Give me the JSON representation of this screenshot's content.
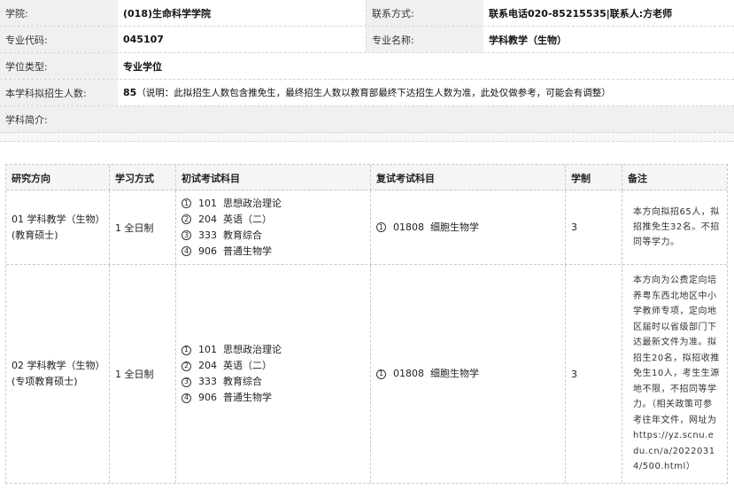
{
  "info": {
    "college_label": "学院:",
    "college_value": "(018)生命科学学院",
    "contact_label": "联系方式:",
    "contact_value": "联系电话020-85215535|联系人:方老师",
    "major_code_label": "专业代码:",
    "major_code_value": "045107",
    "major_name_label": "专业名称:",
    "major_name_value": "学科教学（生物）",
    "degree_type_label": "学位类型:",
    "degree_type_value": "专业学位",
    "enroll_label": "本学科拟招生人数:",
    "enroll_count": "85",
    "enroll_note": "（说明：此拟招生人数包含推免生，最终招生人数以教育部最终下达招生人数为准，此处仅做参考，可能会有调整）",
    "intro_label": "学科简介:"
  },
  "table": {
    "headers": {
      "direction": "研究方向",
      "mode": "学习方式",
      "first_exam": "初试考试科目",
      "retest": "复试考试科目",
      "years": "学制",
      "remark": "备注"
    },
    "rows": [
      {
        "direction_line1": "01 学科教学（生物）",
        "direction_line2": "(教育硕士)",
        "mode": "1 全日制",
        "subjects": [
          {
            "num": "1",
            "code": "101",
            "name": "思想政治理论"
          },
          {
            "num": "2",
            "code": "204",
            "name": "英语（二）"
          },
          {
            "num": "3",
            "code": "333",
            "name": "教育综合"
          },
          {
            "num": "4",
            "code": "906",
            "name": "普通生物学"
          }
        ],
        "retest": {
          "num": "1",
          "code": "01808",
          "name": "细胞生物学"
        },
        "years": "3",
        "remark": "本方向拟招65人，拟招推免生32名。不招同等学力。"
      },
      {
        "direction_line1": "02 学科教学（生物）",
        "direction_line2": "(专项教育硕士)",
        "mode": "1 全日制",
        "subjects": [
          {
            "num": "1",
            "code": "101",
            "name": "思想政治理论"
          },
          {
            "num": "2",
            "code": "204",
            "name": "英语（二）"
          },
          {
            "num": "3",
            "code": "333",
            "name": "教育综合"
          },
          {
            "num": "4",
            "code": "906",
            "name": "普通生物学"
          }
        ],
        "retest": {
          "num": "1",
          "code": "01808",
          "name": "细胞生物学"
        },
        "years": "3",
        "remark": "本方向为公费定向培养粤东西北地区中小学教师专项，定向地区届时以省级部门下达最新文件为准。拟招生20名，拟招收推免生10人，考生生源地不限，不招同等学力。（相关政策可参考往年文件，网址为https://yz.scnu.edu.cn/a/20220314/500.html）"
      }
    ]
  }
}
